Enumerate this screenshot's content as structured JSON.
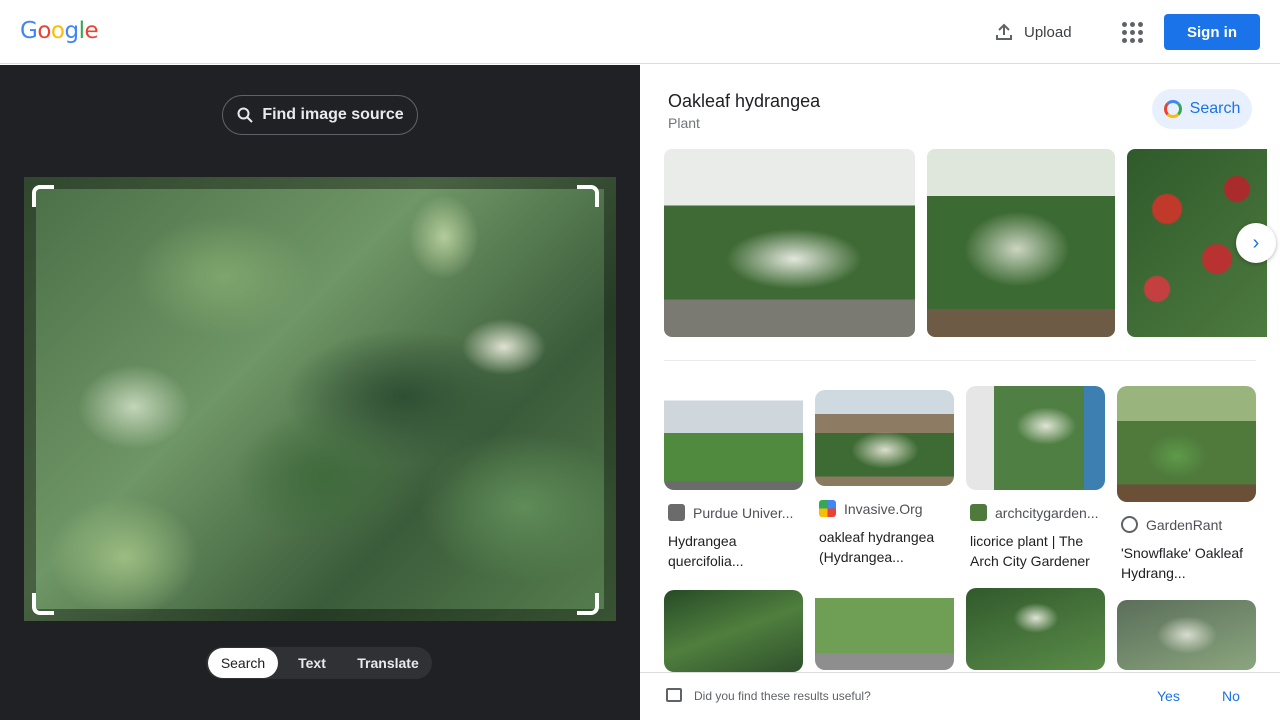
{
  "header": {
    "logo_letters": [
      {
        "ch": "G",
        "color": "#4285F4"
      },
      {
        "ch": "o",
        "color": "#EA4335"
      },
      {
        "ch": "o",
        "color": "#FBBC05"
      },
      {
        "ch": "g",
        "color": "#4285F4"
      },
      {
        "ch": "l",
        "color": "#34A853"
      },
      {
        "ch": "e",
        "color": "#EA4335"
      }
    ],
    "upload_label": "Upload",
    "signin_label": "Sign in",
    "apps_icon": "apps-grid-icon"
  },
  "left": {
    "find_source_label": "Find image source",
    "modes": [
      {
        "label": "Search",
        "active": true
      },
      {
        "label": "Text",
        "active": false
      },
      {
        "label": "Translate",
        "active": false
      }
    ]
  },
  "right": {
    "kg": {
      "title": "Oakleaf hydrangea",
      "subtitle": "Plant",
      "search_label": "Search"
    },
    "results": [
      {
        "source": "Purdue Univer...",
        "title": "Hydrangea quercifolia...",
        "icon_color": "#6b6b6b"
      },
      {
        "source": "Invasive.Org",
        "title": "oakleaf hydrangea (Hydrangea...",
        "icon_color": "#e94235"
      },
      {
        "source": "archcitygarden...",
        "title": "licorice plant | The Arch City Gardener",
        "icon_color": "#4f7a3c"
      },
      {
        "source": "GardenRant",
        "title": "'Snowflake' Oakleaf Hydrang...",
        "icon_color": "#5f6368"
      }
    ]
  },
  "feedback": {
    "question": "Did you find these results useful?",
    "yes": "Yes",
    "no": "No"
  },
  "colors": {
    "accent": "#1a73e8",
    "dark_panel": "#202124"
  }
}
